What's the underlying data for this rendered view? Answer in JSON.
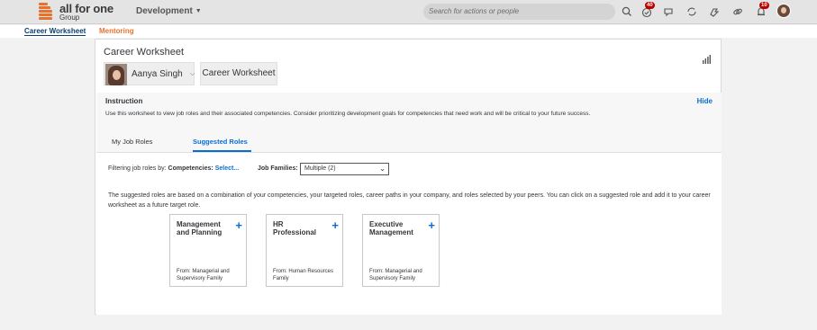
{
  "header": {
    "logo_text": "all for one",
    "logo_sub": "Group",
    "environment": "Development",
    "search_placeholder": "Search for actions or people",
    "tasks_badge": "40",
    "notifications_badge": "10",
    "brand_color": "#e8722c"
  },
  "subnav": {
    "items": [
      {
        "label": "Career Worksheet"
      },
      {
        "label": "Mentoring"
      }
    ]
  },
  "page": {
    "title": "Career Worksheet",
    "person_name": "Aanya Singh",
    "worksheet_button": "Career Worksheet",
    "instruction_title": "Instruction",
    "instruction_hide": "Hide",
    "instruction_text": "Use this worksheet to view job roles and their associated competencies. Consider prioritizing development goals for competencies that need work and will be critical to your future success.",
    "tabs": [
      {
        "label": "My Job Roles"
      },
      {
        "label": "Suggested Roles"
      }
    ],
    "filter_prefix": "Filtering job roles by:",
    "competencies_label": "Competencies:",
    "competencies_link": "Select...",
    "job_families_label": "Job Families:",
    "job_families_value": "Multiple (2)",
    "description": "The suggested roles are based on a combination of your competencies, your targeted roles, career paths in your company, and roles selected by your peers. You can click on a suggested role and add it to your career worksheet as a future target role.",
    "roles": [
      {
        "name": "Management and Planning",
        "from": "From: Managerial and Supervisory Family"
      },
      {
        "name": "HR Professional",
        "from": "From: Human Resources Family"
      },
      {
        "name": "Executive Management",
        "from": "From: Managerial and Supervisory Family"
      }
    ]
  }
}
